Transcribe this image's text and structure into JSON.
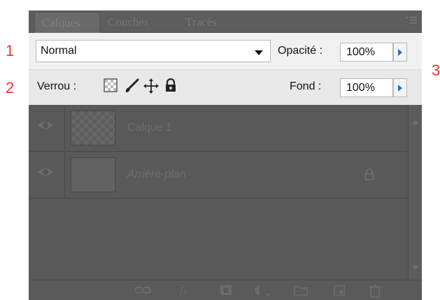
{
  "annotations": {
    "m1": "1",
    "m2": "2",
    "m3": "3"
  },
  "tabs": [
    {
      "label": "Calques",
      "active": true
    },
    {
      "label": "Couches",
      "active": false
    },
    {
      "label": "Tracés",
      "active": false
    }
  ],
  "blend_mode": {
    "value": "Normal"
  },
  "opacity": {
    "label": "Opacité :",
    "value": "100%"
  },
  "lock": {
    "label": "Verrou :"
  },
  "fill": {
    "label": "Fond :",
    "value": "100%"
  },
  "layers": [
    {
      "name": "Calque 1",
      "visible": true,
      "locked": false,
      "transparent_thumb": true
    },
    {
      "name": "Arrière-plan",
      "visible": true,
      "locked": true,
      "transparent_thumb": false
    }
  ],
  "icons": {
    "panel_menu": "panel-menu-icon",
    "lock_transparent": "lock-transparent-pixels-icon",
    "lock_brush": "lock-image-pixels-brush-icon",
    "lock_move": "lock-position-move-icon",
    "lock_all": "lock-all-padlock-icon",
    "eye": "eye-icon",
    "layer_lock": "layer-lock-icon",
    "bottom": [
      "link-layers-icon",
      "fx-icon",
      "add-mask-icon",
      "adjustment-layer-icon",
      "new-group-icon",
      "new-layer-icon",
      "trash-icon"
    ]
  },
  "colors": {
    "annotation": "#e8392b",
    "accent_triangle": "#2f6db7",
    "dim_panel": "#595959"
  }
}
